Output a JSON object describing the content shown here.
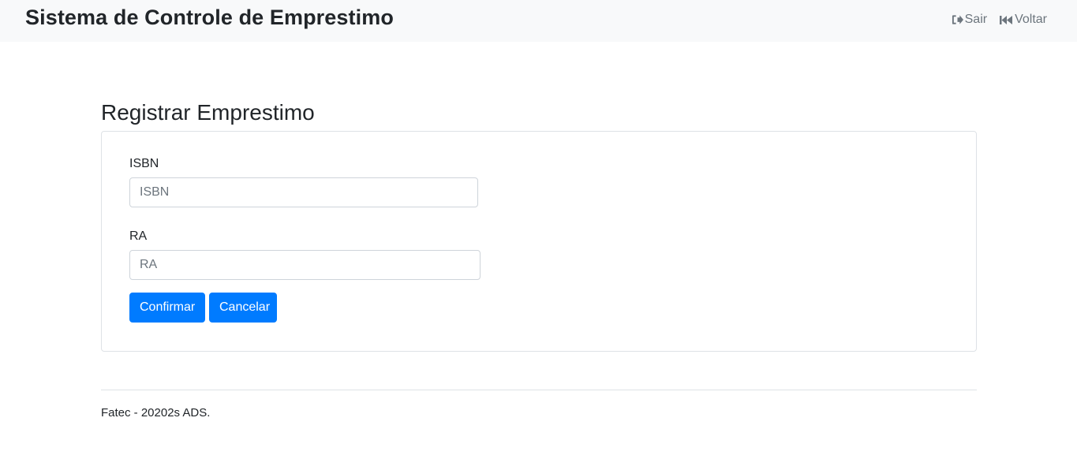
{
  "header": {
    "brand": "Sistema de Controle de Emprestimo",
    "links": [
      {
        "label": "Sair",
        "icon": "sign-out-icon"
      },
      {
        "label": "Voltar",
        "icon": "fast-backward-icon"
      }
    ]
  },
  "main": {
    "title": "Registrar Emprestimo",
    "form": {
      "isbn": {
        "label": "ISBN",
        "placeholder": "ISBN",
        "value": ""
      },
      "ra": {
        "label": "RA",
        "placeholder": "RA",
        "value": ""
      },
      "confirm_label": "Confirmar",
      "cancel_label": "Cancelar"
    }
  },
  "footer": {
    "text": "Fatec - 20202s ADS."
  },
  "colors": {
    "navbar_bg": "#f8f9fa",
    "primary": "#007bff",
    "muted": "#6c757d",
    "border": "#dee2e6"
  }
}
